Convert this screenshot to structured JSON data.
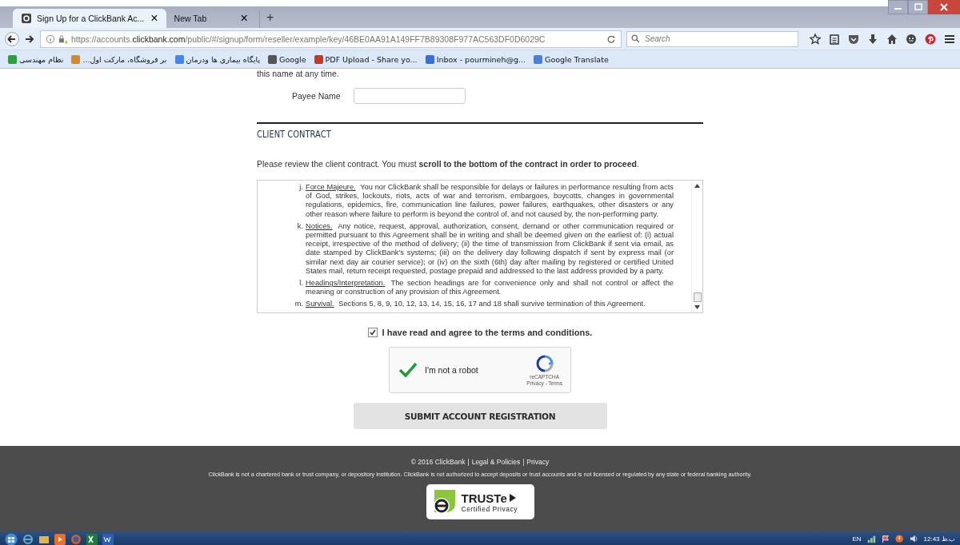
{
  "browser": {
    "tabs": [
      {
        "title": "Sign Up for a ClickBank Ac...",
        "selected": true,
        "close": "×"
      },
      {
        "title": "New Tab",
        "selected": false,
        "close": "×"
      }
    ],
    "new_tab": "+",
    "address": "https://accounts.**clickbank.com**/public/#/signup/form/reseller/example/key/46BE0AA91A149FF7B89308F977AC563DF0D6029C",
    "search": {
      "placeholder": "Search"
    },
    "bookmarks": [
      {
        "label": "نظام مهندسی",
        "color": "#2e9e3e"
      },
      {
        "label": "بر فروشگاه، مارکت اول...",
        "color": "#d48a2a"
      },
      {
        "label": "پایگاه بیماری ها ودرمان",
        "color": "#4285f4"
      },
      {
        "label": "Google",
        "color": "#555555"
      },
      {
        "label": "PDF Upload - Share yo...",
        "color": "#c23b22"
      },
      {
        "label": "Inbox - pourmineh@g...",
        "color": "#3b6fd8"
      },
      {
        "label": "Google Translate",
        "color": "#4a7fe0"
      }
    ]
  },
  "page": {
    "intro_tail": "this name at any time.",
    "payee": {
      "label": "Payee Name"
    },
    "section_title": "CLIENT CONTRACT",
    "instruction": "Please review the client contract. You must **scroll to the bottom of the contract in order to proceed**.",
    "contract": [
      {
        "letter": "j.",
        "heading": "Force Majeure.",
        "text": "You nor ClickBank shall be responsible for delays or failures in performance resulting from acts of God, strikes, lockouts, riots, acts of war and terrorism, embargoes, boycotts, changes in governmental regulations, epidemics, fire, communication line failures, power failures, earthquakes, other disasters or any other reason where failure to perform is beyond the control of, and not caused by, the non-performing party."
      },
      {
        "letter": "k.",
        "heading": "Notices.",
        "text": "Any notice, request, approval, authorization, consent, demand or other communication required or permitted pursuant to this Agreement shall be in writing and shall be deemed given on the earliest of: (i) actual receipt, irrespective of the method of delivery; (ii) the time of transmission from ClickBank if sent via email, as date stamped by ClickBank's systems; (iii) on the delivery day following dispatch if sent by express mail (or similar next day air courier service); or (iv) on the sixth (6th) day after mailing by registered or certified United States mail, return receipt requested, postage prepaid and addressed to the last address provided by a party."
      },
      {
        "letter": "l.",
        "heading": "Headings/Interpretation.",
        "text": "The section headings are for convenience only and shall not control or affect the meaning or construction of any provision of this Agreement."
      },
      {
        "letter": "m.",
        "heading": "Survival.",
        "text": "Sections 5, 8, 9, 10, 12, 13, 14, 15, 16, 17 and 18 shall survive termination of this Agreement."
      }
    ],
    "agree": {
      "label": "I have read and agree to the terms and conditions.",
      "checked": true
    },
    "captcha": {
      "label": "I'm not a robot",
      "checked": true,
      "brand": "reCAPTCHA",
      "links": "Privacy - Terms"
    },
    "submit": "SUBMIT ACCOUNT REGISTRATION"
  },
  "footer": {
    "links": [
      "© 2016 ClickBank",
      "Legal & Policies",
      "Privacy"
    ],
    "separator": "|",
    "disclaimer": "ClickBank is not a chartered bank or trust company, or depository institution. ClickBank is not authorized to accept deposits or trust accounts and is not licensed or regulated by any state or federal banking authority.",
    "badge": {
      "name": "TRUSTe",
      "tagline": "Certified Privacy"
    }
  },
  "taskbar": {
    "language": "EN",
    "clock": "12:43 ب.ظ"
  }
}
